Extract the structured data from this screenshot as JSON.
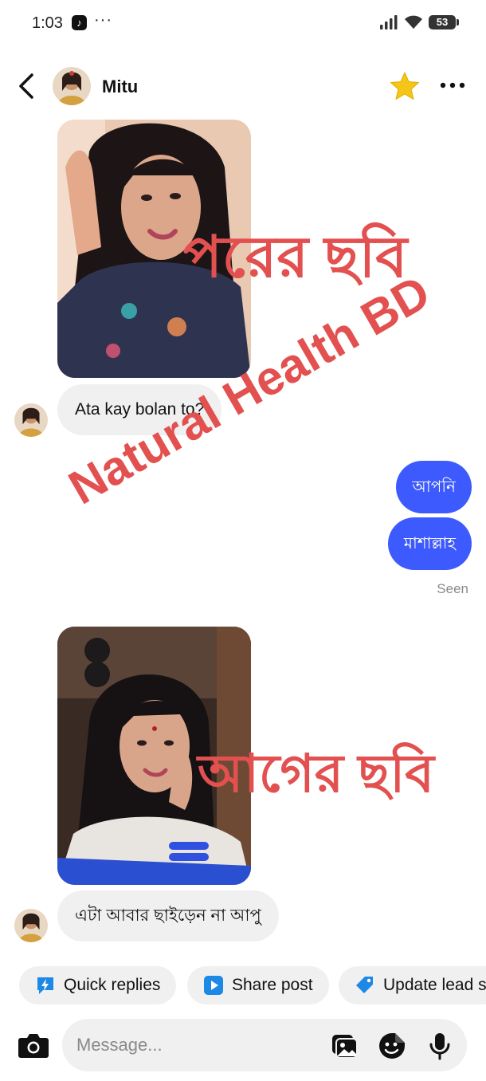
{
  "status_bar": {
    "time": "1:03",
    "battery": "53",
    "more": "···"
  },
  "header": {
    "contact_name": "Mitu"
  },
  "messages": [
    {
      "type": "photo"
    },
    {
      "type": "incoming_text",
      "text": "Ata kay bolan to?"
    },
    {
      "type": "outgoing_text",
      "text": "আপনি"
    },
    {
      "type": "outgoing_text",
      "text": "মাশাল্লাহ"
    },
    {
      "type": "status",
      "text": "Seen"
    },
    {
      "type": "photo"
    },
    {
      "type": "incoming_text",
      "text": "এটা আবার ছাইড়েন  না আপু"
    }
  ],
  "overlays": {
    "after_label": "পরের ছবি",
    "before_label": "আগের ছবি",
    "watermark": "Natural Health BD"
  },
  "quick_actions": [
    {
      "label": "Quick replies",
      "icon": "lightning-icon"
    },
    {
      "label": "Share post",
      "icon": "play-icon"
    },
    {
      "label": "Update lead s",
      "icon": "tag-icon"
    }
  ],
  "composer": {
    "placeholder": "Message..."
  },
  "colors": {
    "outgoing_bubble": "#3d5afe",
    "incoming_bubble": "#f0f0f0",
    "overlay_text": "#e35050",
    "star": "#f5c518"
  }
}
